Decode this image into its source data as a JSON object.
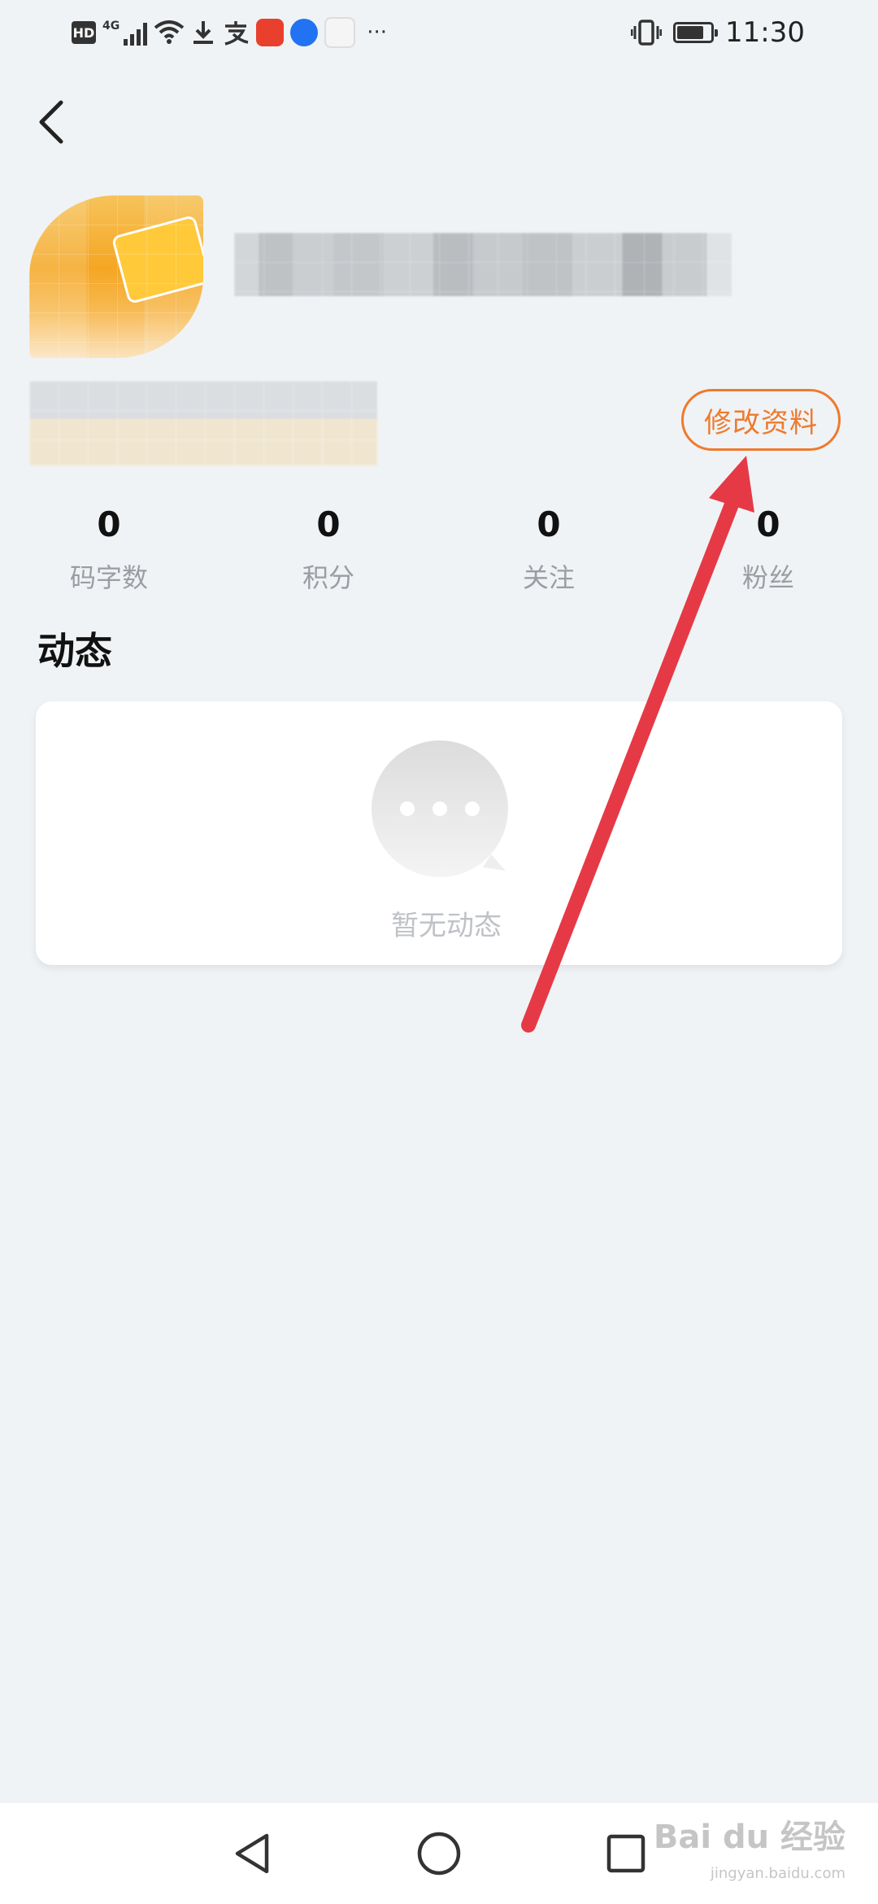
{
  "status_bar": {
    "time": "11:30",
    "network": "4G",
    "hd": "HD",
    "more": "···",
    "icons": [
      "hd-icon",
      "signal-icon",
      "wifi-icon",
      "download-icon",
      "alipay-icon",
      "app-icon-red",
      "app-icon-blue",
      "app-icon-calendar",
      "more-icon",
      "vibrate-icon",
      "battery-icon"
    ],
    "battery_level": 0.8
  },
  "header": {
    "back_icon": "back-arrow-icon"
  },
  "profile": {
    "edit_button_label": "修改资料"
  },
  "stats": [
    {
      "value": "0",
      "label": "码字数"
    },
    {
      "value": "0",
      "label": "积分"
    },
    {
      "value": "0",
      "label": "关注"
    },
    {
      "value": "0",
      "label": "粉丝"
    }
  ],
  "feed": {
    "title": "动态",
    "empty_text": "暂无动态"
  },
  "watermark": {
    "brand": "Bai du 经验",
    "url": "jingyan.baidu.com"
  },
  "colors": {
    "accent": "#ee7a2e",
    "annotation_arrow": "#e63946",
    "background": "#f0f3f5"
  }
}
